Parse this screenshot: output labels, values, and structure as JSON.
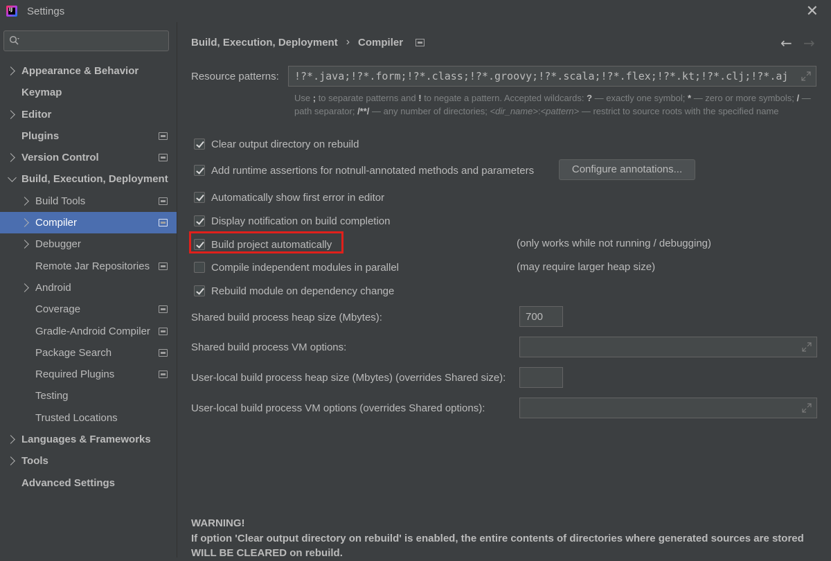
{
  "window": {
    "title": "Settings",
    "app_icon_text": "IJ"
  },
  "search": {
    "placeholder": ""
  },
  "sidebar": {
    "items": [
      {
        "label": "Appearance & Behavior",
        "bold": true,
        "chevron": "right",
        "indent": 0,
        "marker": false
      },
      {
        "label": "Keymap",
        "bold": true,
        "chevron": "none",
        "indent": 0,
        "marker": false
      },
      {
        "label": "Editor",
        "bold": true,
        "chevron": "right",
        "indent": 0,
        "marker": false
      },
      {
        "label": "Plugins",
        "bold": true,
        "chevron": "none",
        "indent": 0,
        "marker": true
      },
      {
        "label": "Version Control",
        "bold": true,
        "chevron": "right",
        "indent": 0,
        "marker": true
      },
      {
        "label": "Build, Execution, Deployment",
        "bold": true,
        "chevron": "down",
        "indent": 0,
        "marker": false
      },
      {
        "label": "Build Tools",
        "bold": false,
        "chevron": "right",
        "indent": 1,
        "marker": true
      },
      {
        "label": "Compiler",
        "bold": false,
        "chevron": "right",
        "indent": 1,
        "marker": true,
        "selected": true
      },
      {
        "label": "Debugger",
        "bold": false,
        "chevron": "right",
        "indent": 1,
        "marker": false
      },
      {
        "label": "Remote Jar Repositories",
        "bold": false,
        "chevron": "none",
        "indent": 1,
        "marker": true
      },
      {
        "label": "Android",
        "bold": false,
        "chevron": "right",
        "indent": 1,
        "marker": false
      },
      {
        "label": "Coverage",
        "bold": false,
        "chevron": "none",
        "indent": 1,
        "marker": true
      },
      {
        "label": "Gradle-Android Compiler",
        "bold": false,
        "chevron": "none",
        "indent": 1,
        "marker": true
      },
      {
        "label": "Package Search",
        "bold": false,
        "chevron": "none",
        "indent": 1,
        "marker": true
      },
      {
        "label": "Required Plugins",
        "bold": false,
        "chevron": "none",
        "indent": 1,
        "marker": true
      },
      {
        "label": "Testing",
        "bold": false,
        "chevron": "none",
        "indent": 1,
        "marker": false
      },
      {
        "label": "Trusted Locations",
        "bold": false,
        "chevron": "none",
        "indent": 1,
        "marker": false
      },
      {
        "label": "Languages & Frameworks",
        "bold": true,
        "chevron": "right",
        "indent": 0,
        "marker": false
      },
      {
        "label": "Tools",
        "bold": true,
        "chevron": "right",
        "indent": 0,
        "marker": false
      },
      {
        "label": "Advanced Settings",
        "bold": true,
        "chevron": "none",
        "indent": 0,
        "marker": false
      }
    ]
  },
  "breadcrumb": {
    "parent": "Build, Execution, Deployment",
    "separator": "›",
    "current": "Compiler"
  },
  "nav": {
    "back": "←",
    "forward": "→"
  },
  "resource_patterns": {
    "label": "Resource patterns:",
    "value": "!?*.java;!?*.form;!?*.class;!?*.groovy;!?*.scala;!?*.flex;!?*.kt;!?*.clj;!?*.aj",
    "hint": {
      "p1": "Use ",
      "k1": ";",
      "p2": " to separate patterns and ",
      "k2": "!",
      "p3": " to negate a pattern. Accepted wildcards: ",
      "k3": "?",
      "p4": " — exactly one symbol; ",
      "k4": "*",
      "p5": " — zero or more symbols; ",
      "k5": "/",
      "p6": " — path separator; ",
      "k6": "/**/",
      "p7": " — any number of directories; ",
      "i1": "<dir_name>",
      "p8": ":",
      "i2": "<pattern>",
      "p9": " — restrict to source roots with the specified name"
    }
  },
  "options": {
    "clear_output": {
      "label": "Clear output directory on rebuild",
      "checked": true
    },
    "runtime_assertions": {
      "label": "Add runtime assertions for notnull-annotated methods and parameters",
      "checked": true
    },
    "configure_button": "Configure annotations...",
    "show_first_error": {
      "label": "Automatically show first error in editor",
      "checked": true
    },
    "notify_completion": {
      "label": "Display notification on build completion",
      "checked": true
    },
    "build_automatically": {
      "label": "Build project automatically",
      "checked": true,
      "note": "(only works while not running / debugging)"
    },
    "parallel": {
      "label": "Compile independent modules in parallel",
      "checked": false,
      "note": "(may require larger heap size)"
    },
    "rebuild_on_dependency": {
      "label": "Rebuild module on dependency change",
      "checked": true
    }
  },
  "heap": {
    "shared_heap_label": "Shared build process heap size (Mbytes):",
    "shared_heap_value": "700",
    "shared_vm_label": "Shared build process VM options:",
    "shared_vm_value": "",
    "user_heap_label": "User-local build process heap size (Mbytes) (overrides Shared size):",
    "user_heap_value": "",
    "user_vm_label": "User-local build process VM options (overrides Shared options):",
    "user_vm_value": ""
  },
  "warning": {
    "title": "WARNING!",
    "line1": "If option 'Clear output directory on rebuild' is enabled, the entire contents of directories where generated sources are stored",
    "line2": "WILL BE CLEARED on rebuild."
  },
  "colors": {
    "background": "#3c3f41",
    "selection": "#4b6eaf",
    "highlight": "#e0201b",
    "field": "#45494a"
  }
}
